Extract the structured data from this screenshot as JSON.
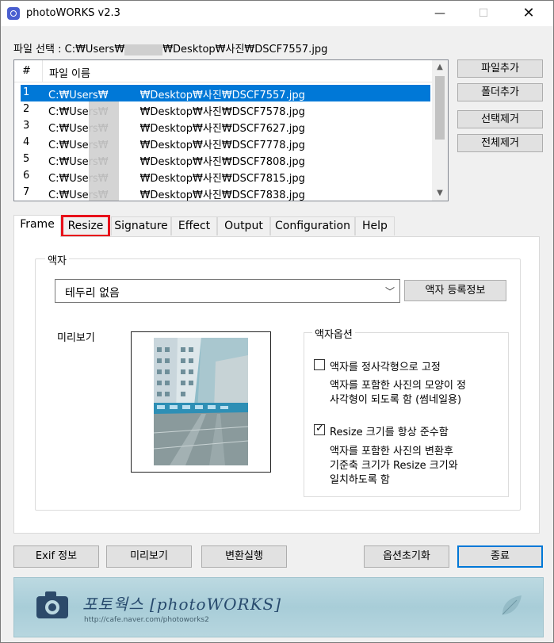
{
  "window": {
    "title": "photoWORKS v2.3",
    "min_glyph": "—",
    "max_glyph": "☐",
    "close_glyph": "✕"
  },
  "file_select": {
    "label": "파일 선택 : C:₩Users₩",
    "label_tail": "₩Desktop₩사진₩DSCF7557.jpg"
  },
  "file_list": {
    "col_num": "#",
    "col_name": "파일 이름",
    "rows": [
      {
        "num": "1",
        "prefix": "C:₩Users₩",
        "suffix": "₩Desktop₩사진₩DSCF7557.jpg",
        "selected": true
      },
      {
        "num": "2",
        "prefix": "C:₩Users₩",
        "suffix": "₩Desktop₩사진₩DSCF7578.jpg",
        "selected": false
      },
      {
        "num": "3",
        "prefix": "C:₩Users₩",
        "suffix": "₩Desktop₩사진₩DSCF7627.jpg",
        "selected": false
      },
      {
        "num": "4",
        "prefix": "C:₩Users₩",
        "suffix": "₩Desktop₩사진₩DSCF7778.jpg",
        "selected": false
      },
      {
        "num": "5",
        "prefix": "C:₩Users₩",
        "suffix": "₩Desktop₩사진₩DSCF7808.jpg",
        "selected": false
      },
      {
        "num": "6",
        "prefix": "C:₩Users₩",
        "suffix": "₩Desktop₩사진₩DSCF7815.jpg",
        "selected": false
      },
      {
        "num": "7",
        "prefix": "C:₩Users₩",
        "suffix": "₩Desktop₩사진₩DSCF7838.jpg",
        "selected": false
      }
    ]
  },
  "side_buttons": [
    "파일추가",
    "폴더추가",
    "선택제거",
    "전체제거"
  ],
  "tabs": [
    "Frame",
    "Resize",
    "Signature",
    "Effect",
    "Output",
    "Configuration",
    "Help"
  ],
  "active_tab": "Frame",
  "highlighted_tab": "Resize",
  "frame_panel": {
    "group_title": "액자",
    "frame_select_value": "테두리 없음",
    "register_button": "액자 등록정보",
    "preview_label": "미리보기",
    "options_title": "액자옵션",
    "option1_label": "액자를 정사각형으로 고정",
    "option1_checked": false,
    "option1_desc_line1": "액자를 포함한 사진의 모양이 정",
    "option1_desc_line2": "사각형이 되도록 함 (썸네일용)",
    "option2_label": "Resize 크기를 항상 준수함",
    "option2_checked": true,
    "option2_desc_line1": "액자를 포함한 사진의 변환후",
    "option2_desc_line2": "기준축 크기가 Resize 크기와",
    "option2_desc_line3": "일치하도록 함"
  },
  "bottom_buttons": {
    "exif": "Exif 정보",
    "preview": "미리보기",
    "convert": "변환실행",
    "reset": "옵션초기화",
    "exit": "종료"
  },
  "banner": {
    "title": "포토웍스 [photoWORKS]",
    "url": "http://cafe.naver.com/photoworks2"
  },
  "colors": {
    "selection": "#0078d7",
    "highlight_box": "#e8101a",
    "banner_text": "#274a6d"
  }
}
